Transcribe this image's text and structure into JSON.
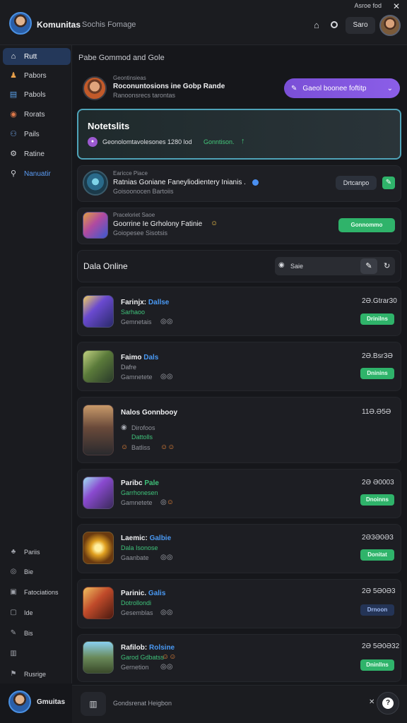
{
  "app": {
    "title": "Komunitas",
    "subtitle": "Sochis Fomage",
    "top_meta": "Asroe fod",
    "top_button": "Saro"
  },
  "sidebar": {
    "items": [
      {
        "label": "Rutt",
        "icon": "home-icon",
        "glyph": "⌂"
      },
      {
        "label": "Pabors",
        "icon": "person-icon",
        "glyph": "♟"
      },
      {
        "label": "Pabols",
        "icon": "clipboard-icon",
        "glyph": "▤"
      },
      {
        "label": "Rorats",
        "icon": "game-icon",
        "glyph": "◉"
      },
      {
        "label": "Pails",
        "icon": "people-icon",
        "glyph": "⚇"
      },
      {
        "label": "Ratine",
        "icon": "gear-icon",
        "glyph": "⚙"
      },
      {
        "label": "Nanuatir",
        "icon": "search-icon",
        "glyph": "⚲"
      }
    ],
    "bottom_items": [
      {
        "label": "Pariis",
        "glyph": "♣"
      },
      {
        "label": "Bie",
        "glyph": "◎"
      },
      {
        "label": "Fatociations",
        "glyph": "▣"
      },
      {
        "label": "Ide",
        "glyph": "▢"
      },
      {
        "label": "Bis",
        "glyph": "✎"
      },
      {
        "label": "",
        "glyph": "▥"
      },
      {
        "label": "Rusrige",
        "glyph": "⚑"
      }
    ],
    "user_name": "Gmuitas"
  },
  "main": {
    "header": "Pabe Gommod and Gole",
    "profile": {
      "label": "Geontinsieas",
      "line1": "Roconuntosions ine Gobp Rande",
      "line2": "Ranoonsrecs tarontas",
      "button": "Gaeol boonee foftitp"
    },
    "notification": {
      "title": "Notetslits",
      "text": "Geonolomtavolesones 1280 lod",
      "link": "Gonntison."
    },
    "activities": [
      {
        "label": "Earicce Piace",
        "title": "Ratnias Goniane Faneyliodientery Inianis .",
        "sub": "Goisoonocen Bartoiis",
        "button": "Drtcanpo"
      },
      {
        "label": "Praceloriet Saoe",
        "title": "Goorrine Ie Grholony Fatinie",
        "sub": "Goiopesee Sisotsis",
        "button": "Gonnommo"
      }
    ],
    "online": {
      "title": "Dala Online",
      "filter_label": "Saie"
    },
    "friends": [
      {
        "name": "Farinjx:",
        "status": "Dallse",
        "game": "Sarhaoo",
        "game_green": true,
        "sub": "Gemnetais",
        "time": "2Ə.Gtrar30",
        "action": "Drinilns",
        "action_style": "green"
      },
      {
        "name": "Faimo",
        "status": "Dals",
        "game": "Dafre",
        "game_green": false,
        "sub": "Gamnetete",
        "time": "2Ə.Bsr3Ə",
        "action": "Dninins",
        "action_style": "green"
      },
      {
        "name": "Nalos Gonnbooy",
        "status": "",
        "game": "Dattolls",
        "game_green": true,
        "sub": "Dirofoos",
        "extra": "Batliss",
        "time": "11Ə.Ə5Ə",
        "action": "",
        "action_style": "none"
      },
      {
        "name": "Paribc",
        "status": "Pale",
        "game": "Garrhonesen",
        "game_green": true,
        "sub": "Gamnetete",
        "time": "2Ə Ə0003",
        "action": "Dnoinns",
        "action_style": "green"
      },
      {
        "name": "Laemic:",
        "status": "Galbie",
        "game": "Dala Isonose",
        "game_green": true,
        "sub": "Gaanbate",
        "time": "2Ə3Ə0Ə3",
        "action": "Donitat",
        "action_style": "green"
      },
      {
        "name": "Parinic.",
        "status": "Galis",
        "game": "Dotrollondi",
        "game_green": true,
        "sub": "Gesemblas",
        "time": "2Ə 5Ə0Ə3",
        "action": "Drnoon",
        "action_style": "blue"
      },
      {
        "name": "Rafilob:",
        "status": "Rolsine",
        "game": "Garod Gdbatss",
        "game_green": true,
        "sub": "Gernetion",
        "time": "2Ə 5Ə0Ə32",
        "action": "Dninllns",
        "action_style": "green"
      }
    ]
  },
  "bottom": {
    "placeholder": "Gondsrenat Heigbon",
    "close": "✕"
  },
  "colors": {
    "accent_blue": "#4a9af5",
    "accent_green": "#2fb36a",
    "accent_purple": "#8b5ee8",
    "notif_border": "#4fa3b8"
  }
}
